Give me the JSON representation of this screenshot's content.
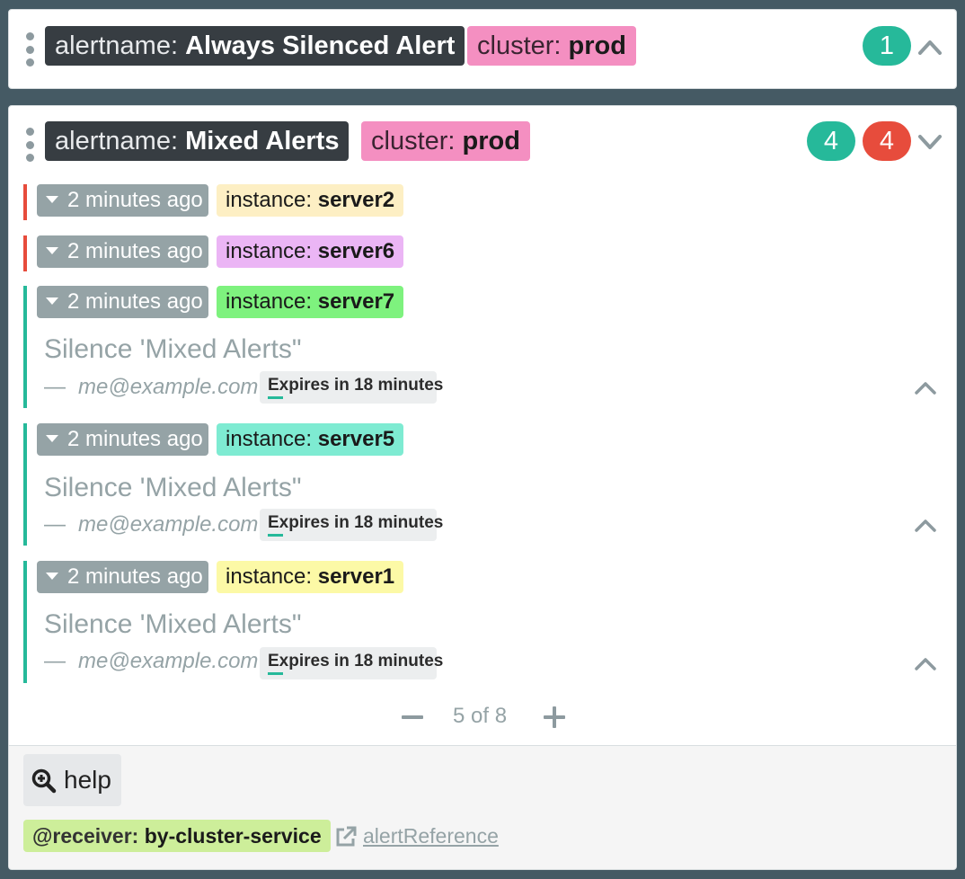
{
  "groups": [
    {
      "labels": [
        {
          "key": "alertname:",
          "value": "Always Silenced Alert"
        },
        {
          "key": "cluster:",
          "value": "prod"
        }
      ],
      "counts": [
        {
          "value": "1",
          "color": "#26b99a"
        }
      ],
      "toggle_icon": "chevron-up-icon"
    },
    {
      "labels": [
        {
          "key": "alertname:",
          "value": "Mixed Alerts"
        },
        {
          "key": "cluster:",
          "value": "prod"
        }
      ],
      "counts": [
        {
          "value": "4",
          "color": "#26b99a"
        },
        {
          "value": "4",
          "color": "#e74c3c"
        }
      ],
      "toggle_icon": "chevron-down-icon",
      "alerts": [
        {
          "state": "active",
          "time": "2 minutes ago",
          "label_key": "instance:",
          "label_value": "server2",
          "label_color": "#fdefc4"
        },
        {
          "state": "active",
          "time": "2 minutes ago",
          "label_key": "instance:",
          "label_value": "server6",
          "label_color": "#ebb5f5"
        },
        {
          "state": "silenced",
          "time": "2 minutes ago",
          "label_key": "instance:",
          "label_value": "server7",
          "label_color": "#7ef27e",
          "silence": {
            "comment": "Silence 'Mixed Alerts\"",
            "dash": "—",
            "author": "me@example.com",
            "expires": "Expires in 18 minutes",
            "expires_progress": 0.1
          }
        },
        {
          "state": "silenced",
          "time": "2 minutes ago",
          "label_key": "instance:",
          "label_value": "server5",
          "label_color": "#7eebd2",
          "silence": {
            "comment": "Silence 'Mixed Alerts\"",
            "dash": "—",
            "author": "me@example.com",
            "expires": "Expires in 18 minutes",
            "expires_progress": 0.1
          }
        },
        {
          "state": "silenced",
          "time": "2 minutes ago",
          "label_key": "instance:",
          "label_value": "server1",
          "label_color": "#fcf9a6",
          "silence": {
            "comment": "Silence 'Mixed Alerts\"",
            "dash": "—",
            "author": "me@example.com",
            "expires": "Expires in 18 minutes",
            "expires_progress": 0.1
          }
        }
      ],
      "pagination": {
        "text": "5 of 8"
      },
      "footer": {
        "help_label": "help",
        "receiver_key": "@receiver:",
        "receiver_value": "by-cluster-service",
        "annotation_link": "alertReference"
      }
    }
  ],
  "colors": {
    "background": "#455a64",
    "active": "#e74c3c",
    "silenced": "#26b99a",
    "muted": "#95a3a6"
  }
}
